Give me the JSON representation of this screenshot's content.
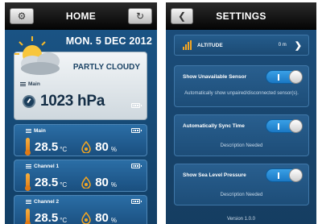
{
  "home": {
    "title": "HOME",
    "settings_icon": "gear-icon",
    "refresh_icon": "refresh-icon",
    "date": "MON. 5 DEC 2012",
    "weather": {
      "condition": "PARTLY CLOUDY",
      "icon": "partly-cloudy-icon",
      "sensor_label": "Main",
      "pressure": "1023 hPa"
    },
    "sensors": [
      {
        "name": "Main",
        "temp": "28.5",
        "temp_unit": "°C",
        "humidity": "80",
        "humidity_unit": "%"
      },
      {
        "name": "Channel 1",
        "temp": "28.5",
        "temp_unit": "°C",
        "humidity": "80",
        "humidity_unit": "%"
      },
      {
        "name": "Channel 2",
        "temp": "28.5",
        "temp_unit": "°C",
        "humidity": "80",
        "humidity_unit": "%"
      }
    ]
  },
  "settings": {
    "title": "SETTINGS",
    "back_icon": "back-icon",
    "altitude": {
      "label": "ALTITUDE",
      "value": "0 m"
    },
    "options": [
      {
        "label": "Show Unavailable Sensor",
        "description": "Automatically show unpaired/disconnected sensor(s).",
        "enabled": true
      },
      {
        "label": "Automatically Sync Time",
        "description": "Description Needed",
        "enabled": true
      },
      {
        "label": "Show Sea Level Pressure",
        "description": "Description Needed",
        "enabled": true
      }
    ],
    "version": "Version 1.0.0"
  },
  "colors": {
    "accent_orange": "#f3a521",
    "toggle_blue": "#2a8ad6",
    "panel_blue": "#1b5688"
  }
}
